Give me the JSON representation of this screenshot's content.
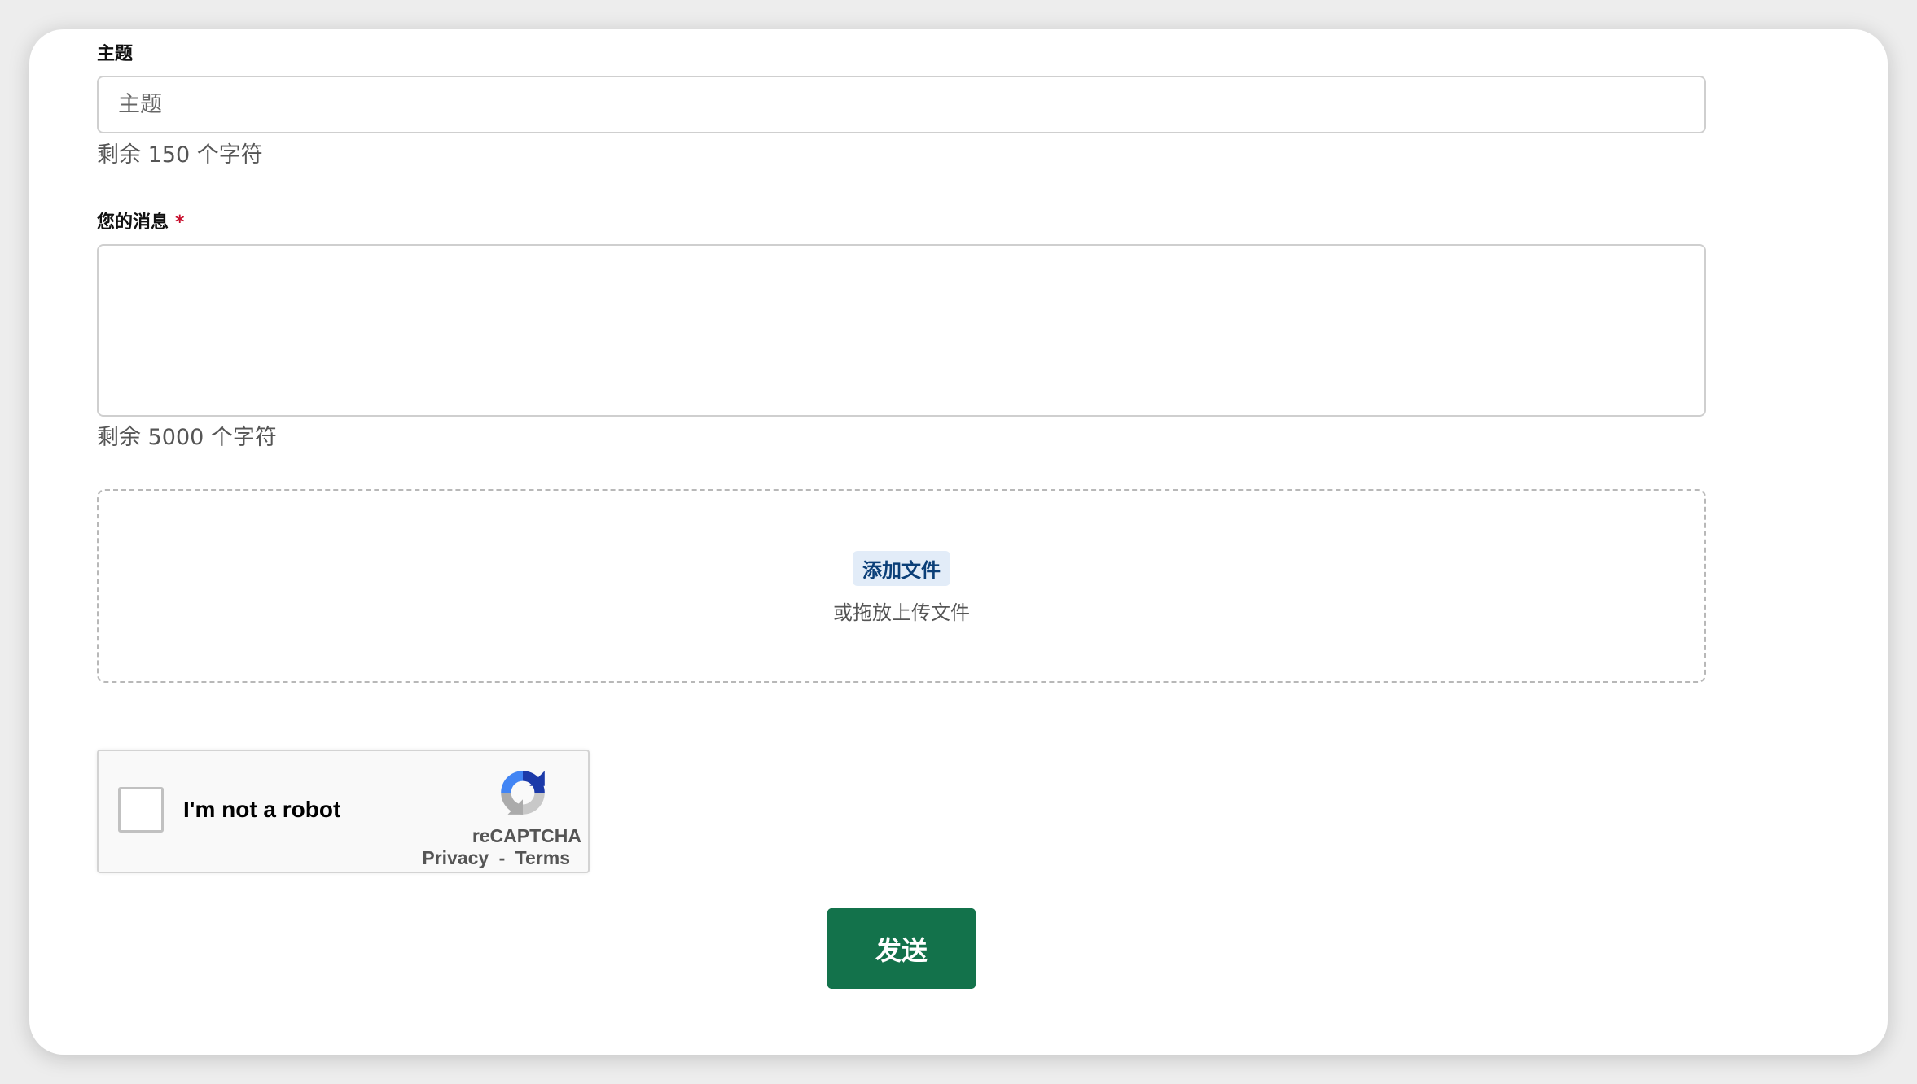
{
  "form": {
    "subject": {
      "label": "主题",
      "placeholder": "主题",
      "value": "",
      "counter": "剩余 150 个字符"
    },
    "message": {
      "label": "您的消息",
      "required_mark": "*",
      "placeholder": "",
      "value": "",
      "counter": "剩余 5000 个字符"
    },
    "upload": {
      "add_file_label": "添加文件",
      "drop_hint": "或拖放上传文件"
    },
    "recaptcha": {
      "checkbox_label": "I'm not a robot",
      "brand": "reCAPTCHA",
      "privacy": "Privacy",
      "separator": "-",
      "terms": "Terms",
      "icon": "recaptcha-logo-icon"
    },
    "submit_label": "发送"
  },
  "colors": {
    "primary_button": "#13724b",
    "add_file_bg": "#e2ecf8",
    "add_file_text": "#0b3f78",
    "required": "#c8102e"
  }
}
